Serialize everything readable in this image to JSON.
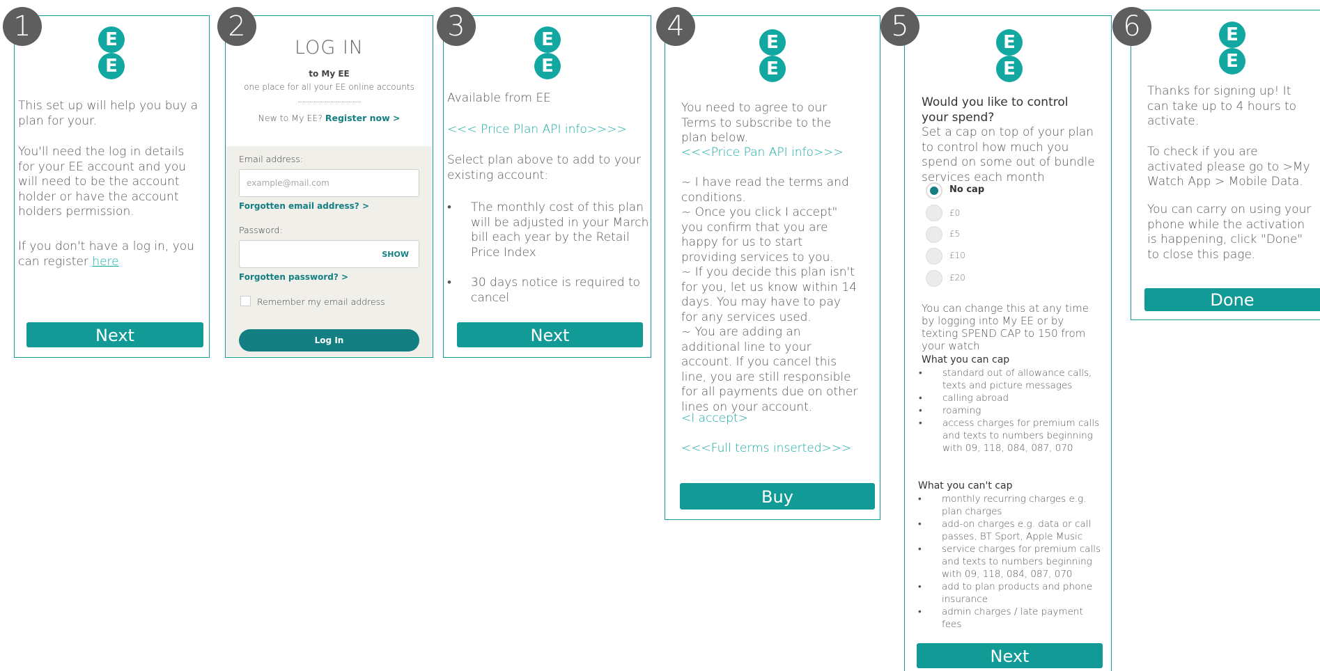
{
  "badges": [
    "1",
    "2",
    "3",
    "4",
    "5",
    "6"
  ],
  "logo_letters": [
    "E",
    "E"
  ],
  "panel1": {
    "para1": "This set up will help you buy a plan for your.",
    "para2": "You'll need the log in details for your EE account and you will need to be the account holder or have the account holders permission.",
    "para3_prefix": "If you don't have a log in, you can register ",
    "para3_link": "here",
    "next_label": "Next"
  },
  "panel2": {
    "title": "LOG IN",
    "subtitle": "to My EE",
    "tagline": "one place for all your EE online accounts",
    "new_prefix": "New to My EE? ",
    "register_label": "Register now >",
    "email_label": "Email address:",
    "email_placeholder": "example@mail.com",
    "forgot_email": "Forgotten email address?  >",
    "password_label": "Password:",
    "show_label": "SHOW",
    "forgot_password": "Forgotten password?  >",
    "remember_label": "Remember my email address",
    "login_label": "Log In"
  },
  "panel3": {
    "available": "Available from EE",
    "api_link": "<<< Price Plan API info>>>>",
    "select_text": "Select plan above to add to your existing account:",
    "bullets": [
      "The monthly cost of this plan will be adjusted in your March bill each year by the Retail Price Index",
      "30 days notice is required to cancel"
    ],
    "next_label": "Next"
  },
  "panel4": {
    "intro": "You need to agree to our Terms to subscribe to the plan below.",
    "api_link": "<<<Price Pan API info>>>",
    "terms": [
      "~ I have read the terms and conditions.",
      "~ Once you click I accept\" you confirm that you are happy for us to start providing services to you.",
      "~ If you decide this plan isn't for you, let us know within 14 days. You may have to pay for any services used.",
      "~ You are adding an additional line to your account. If you cancel this line, you are still responsible for all payments due on other lines on your account."
    ],
    "accept_link": "<I accept>",
    "full_terms_link": "<<<Full terms inserted>>>",
    "buy_label": "Buy"
  },
  "panel5": {
    "question": "Would you like to control your spend?",
    "description": "Set a cap on top of your plan to control how much you spend on some out of bundle services each month",
    "options": [
      "No cap",
      "£0",
      "£5",
      "£10",
      "£20"
    ],
    "selected_option": "No cap",
    "change_text": "You can change this at any time  by logging into My EE or by texting SPEND CAP to 150 from your watch",
    "can_cap_heading": "What you can cap",
    "can_cap": [
      "standard out of allowance calls, texts and picture messages",
      "calling abroad",
      "roaming",
      "access charges for premium calls and texts to numbers beginning with 09, 118, 084, 087, 070"
    ],
    "cant_cap_heading": "What you can't cap",
    "cant_cap": [
      "monthly recurring charges e.g. plan charges",
      "add-on charges e.g. data or call passes, BT Sport, Apple Music",
      "service charges for premium calls and texts to numbers beginning with 09, 118, 084, 087, 070",
      "add to plan products and phone insurance",
      "admin charges / late payment fees"
    ],
    "next_label": "Next"
  },
  "panel6": {
    "para1": "Thanks for signing up! It can take up to 4 hours to activate.",
    "para2": "To check if you are activated please go to >My Watch App > Mobile Data.",
    "para3": "You can carry on using your phone while the activation is happening, click \"Done\" to close this page.",
    "done_label": "Done"
  },
  "colors": {
    "border": "#139a96",
    "button": "#129a96",
    "logo": "#12a8a1",
    "link": "#12a8a1",
    "badge": "#5e5e5e",
    "login_button": "#137f82"
  }
}
